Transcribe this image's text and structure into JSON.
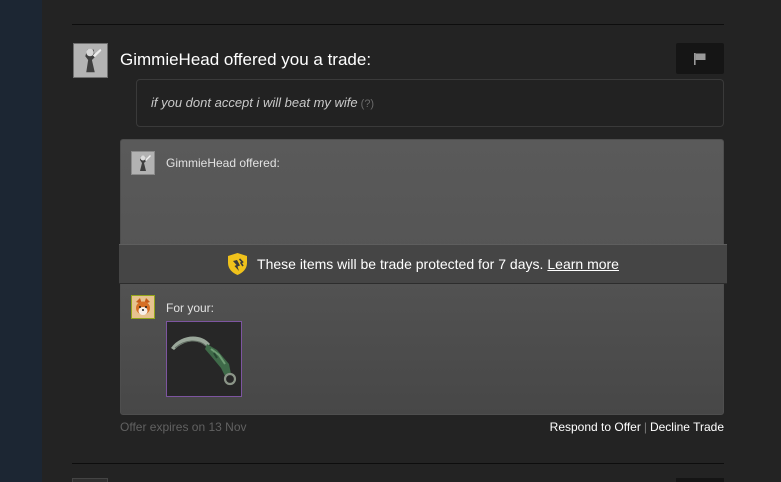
{
  "trade": {
    "sender_name": "GimmieHead",
    "headline": "GimmieHead offered you a trade:",
    "message": "if you dont accept i will beat my wife",
    "message_help": "(?)",
    "report_icon": "flag-icon"
  },
  "offer": {
    "them_label": "GimmieHead offered:",
    "you_label": "For your:",
    "protection_text": "These items will be trade protected for 7 days.",
    "protection_link": "Learn more",
    "protection_icon": "trade-protection-shield-icon",
    "item_icon": "karambit-knife-icon",
    "item_border_color": "#7d55a0"
  },
  "footer": {
    "expires": "Offer expires on 13 Nov",
    "respond": "Respond to Offer",
    "separator": "|",
    "decline": "Decline Trade"
  },
  "colors": {
    "background": "#232323",
    "offer_panel": "#555555",
    "shield": "#f0c21b"
  }
}
